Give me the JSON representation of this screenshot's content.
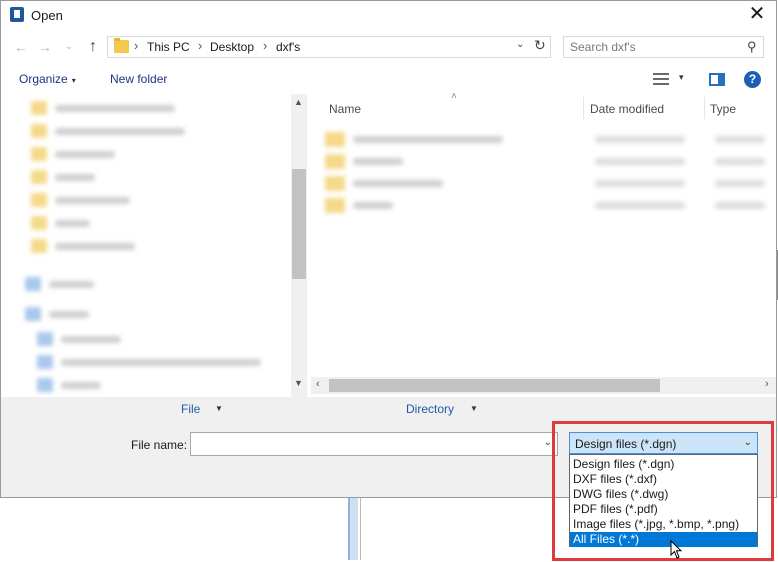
{
  "window": {
    "title": "Open",
    "close": "✕"
  },
  "nav": {
    "back": "←",
    "forward": "→",
    "recent": "⌄",
    "up": "↑"
  },
  "address": {
    "crumbs": [
      "This PC",
      "Desktop",
      "dxf's"
    ],
    "separator": "›",
    "dropdown": "⌄",
    "refresh": "↻"
  },
  "search": {
    "placeholder": "Search dxf's",
    "icon": "⚲"
  },
  "toolbar": {
    "organize_label": "Organize",
    "new_folder_label": "New folder",
    "caret": "▾",
    "help": "?"
  },
  "columns": {
    "name": "Name",
    "date_modified": "Date modified",
    "type": "Type",
    "sort_indicator": "˄"
  },
  "options": {
    "file_label": "File",
    "directory_label": "Directory",
    "caret": "▼"
  },
  "filename": {
    "label": "File name:",
    "value": "",
    "dropdown": "⌄"
  },
  "filetype": {
    "selected": "Design files (*.dgn)",
    "chevron": "⌄",
    "options": [
      "Design files (*.dgn)",
      "DXF files (*.dxf)",
      "DWG files (*.dwg)",
      "PDF files (*.pdf)",
      "Image files (*.jpg, *.bmp, *.png)",
      "All Files (*.*)"
    ],
    "highlighted_index": 5
  },
  "colors": {
    "accent": "#0078d7",
    "highlight_box": "#e0393b",
    "link": "#1e3287"
  }
}
